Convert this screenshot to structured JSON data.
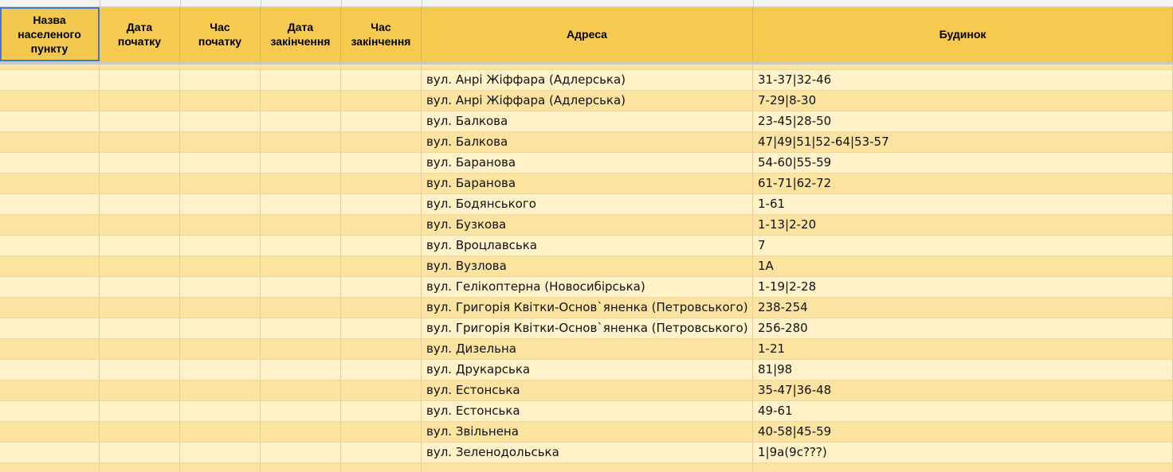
{
  "headers": {
    "col1": "Назва\nнаселеного\nпункту",
    "col2": "Дата\nпочатку",
    "col3": "Час\nпочатку",
    "col4": "Дата\nзакінчення",
    "col5": "Час\nзакінчення",
    "col6": "Адреса",
    "col7": "Будинок"
  },
  "rows": [
    {
      "address": "вул. Анрі Жіффара (Адлерська)",
      "house": "31-37|32-46"
    },
    {
      "address": "вул. Анрі Жіффара (Адлерська)",
      "house": "7-29|8-30"
    },
    {
      "address": "вул. Балкова",
      "house": "23-45|28-50"
    },
    {
      "address": "вул. Балкова",
      "house": "47|49|51|52-64|53-57"
    },
    {
      "address": "вул. Баранова",
      "house": "54-60|55-59"
    },
    {
      "address": "вул. Баранова",
      "house": "61-71|62-72"
    },
    {
      "address": "вул. Бодянського",
      "house": "1-61"
    },
    {
      "address": "вул. Бузкова",
      "house": "1-13|2-20"
    },
    {
      "address": "вул. Вроцлавська",
      "house": "7"
    },
    {
      "address": "вул. Вузлова",
      "house": "1А"
    },
    {
      "address": "вул. Гелікоптерна (Новосибірська)",
      "house": "1-19|2-28"
    },
    {
      "address": "вул. Григорія Квітки-Основ`яненка (Петровського)",
      "house": "238-254"
    },
    {
      "address": "вул. Григорія Квітки-Основ`яненка (Петровського)",
      "house": "256-280"
    },
    {
      "address": "вул. Дизельна",
      "house": "1-21"
    },
    {
      "address": "вул. Друкарська",
      "house": "81|98"
    },
    {
      "address": "вул. Естонська",
      "house": "35-47|36-48"
    },
    {
      "address": "вул. Естонська",
      "house": "49-61"
    },
    {
      "address": "вул. Звільнена",
      "house": "40-58|45-59"
    },
    {
      "address": "вул. Зеленодольська",
      "house": "1|9а(9с???)"
    }
  ]
}
